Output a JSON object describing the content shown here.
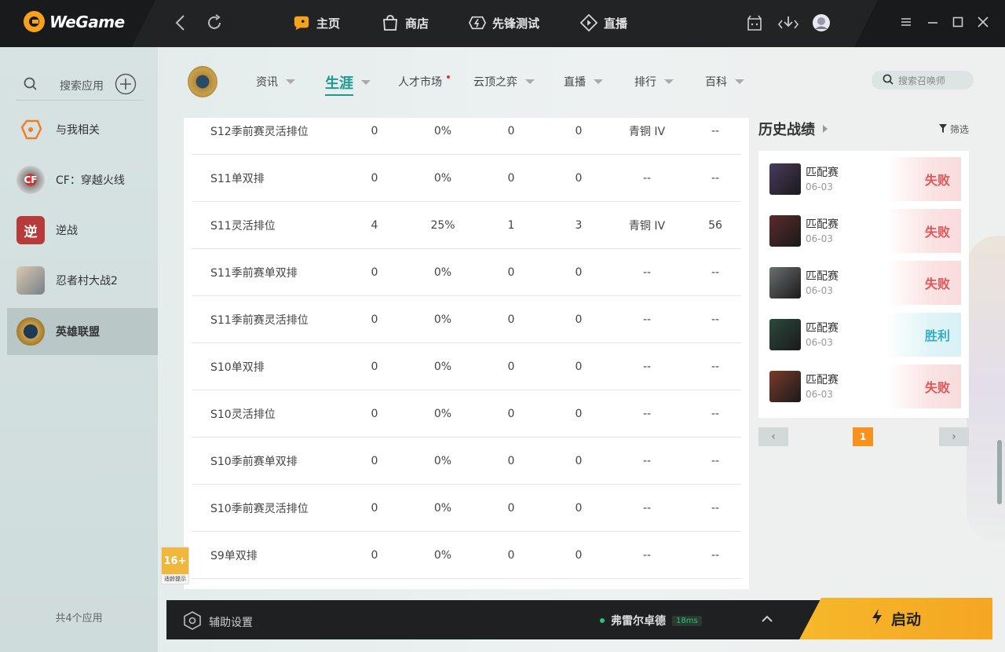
{
  "topbar": {
    "brand": "WeGame",
    "nav": [
      {
        "label": "主页",
        "icon": "home-icon",
        "active": true
      },
      {
        "label": "商店",
        "icon": "store-icon"
      },
      {
        "label": "先锋测试",
        "icon": "pioneer-icon"
      },
      {
        "label": "直播",
        "icon": "live-icon"
      }
    ]
  },
  "sidebar": {
    "search_label": "搜索应用",
    "apps": [
      {
        "label": "与我相关",
        "icon": "related-icon"
      },
      {
        "label": "CF：穿越火线",
        "icon": "cf-icon"
      },
      {
        "label": "逆战",
        "icon": "nizhan-icon"
      },
      {
        "label": "忍者村大战2",
        "icon": "ninja-icon"
      },
      {
        "label": "英雄联盟",
        "icon": "lol-icon",
        "active": true
      }
    ],
    "app_count": "共4个应用"
  },
  "game_nav": [
    {
      "label": "资讯",
      "caret": true
    },
    {
      "label": "生涯",
      "caret": true,
      "active": true
    },
    {
      "label": "人才市场",
      "dot": true
    },
    {
      "label": "云顶之弈",
      "caret": true
    },
    {
      "label": "直播",
      "caret": true
    },
    {
      "label": "排行",
      "caret": true
    },
    {
      "label": "百科",
      "caret": true
    }
  ],
  "summoner_search_placeholder": "搜索召唤师",
  "season_table": {
    "rows": [
      [
        "S12季前赛灵活排位",
        "0",
        "0%",
        "0",
        "0",
        "青铜 IV",
        "--"
      ],
      [
        "S11单双排",
        "0",
        "0%",
        "0",
        "0",
        "--",
        "--"
      ],
      [
        "S11灵活排位",
        "4",
        "25%",
        "1",
        "3",
        "青铜 IV",
        "56"
      ],
      [
        "S11季前赛单双排",
        "0",
        "0%",
        "0",
        "0",
        "--",
        "--"
      ],
      [
        "S11季前赛灵活排位",
        "0",
        "0%",
        "0",
        "0",
        "--",
        "--"
      ],
      [
        "S10单双排",
        "0",
        "0%",
        "0",
        "0",
        "--",
        "--"
      ],
      [
        "S10灵活排位",
        "0",
        "0%",
        "0",
        "0",
        "--",
        "--"
      ],
      [
        "S10季前赛单双排",
        "0",
        "0%",
        "0",
        "0",
        "--",
        "--"
      ],
      [
        "S10季前赛灵活排位",
        "0",
        "0%",
        "0",
        "0",
        "--",
        "--"
      ],
      [
        "S9单双排",
        "0",
        "0%",
        "0",
        "0",
        "--",
        "--"
      ]
    ]
  },
  "history": {
    "title": "历史战绩",
    "filter_label": "筛选",
    "matches": [
      {
        "mode": "匹配赛",
        "date": "06-03",
        "result": "失败",
        "win": false,
        "color": "#4a3b5e"
      },
      {
        "mode": "匹配赛",
        "date": "06-03",
        "result": "失败",
        "win": false,
        "color": "#5a2a2a"
      },
      {
        "mode": "匹配赛",
        "date": "06-03",
        "result": "失败",
        "win": false,
        "color": "#6a6f70"
      },
      {
        "mode": "匹配赛",
        "date": "06-03",
        "result": "胜利",
        "win": true,
        "color": "#2b4a3e"
      },
      {
        "mode": "匹配赛",
        "date": "06-03",
        "result": "失败",
        "win": false,
        "color": "#7a3a2a"
      }
    ],
    "page": "1"
  },
  "age_badge": {
    "rating": "16+",
    "note": "适龄提示"
  },
  "bottombar": {
    "assist_label": "辅助设置",
    "server": "弗雷尔卓德",
    "ping": "18ms",
    "launch_label": "启动"
  }
}
